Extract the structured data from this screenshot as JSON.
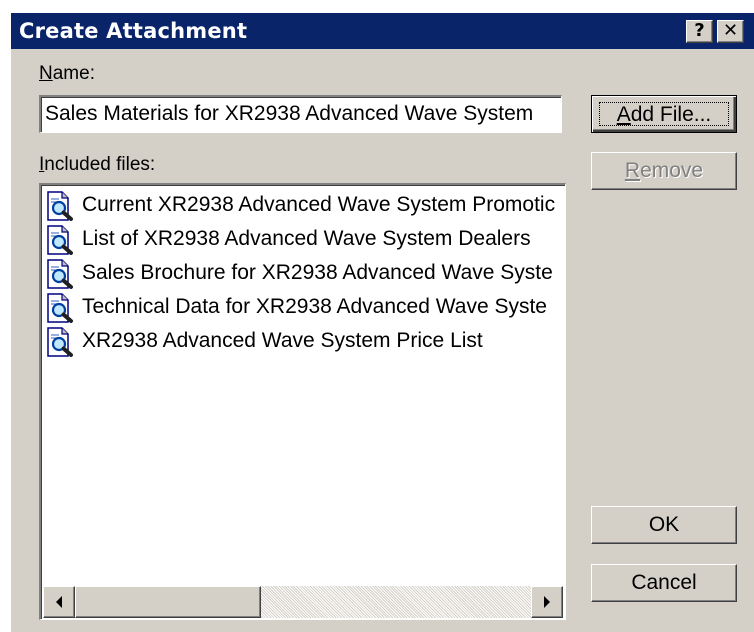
{
  "window": {
    "title": "Create Attachment",
    "help_label": "?",
    "close_label": "✕"
  },
  "name_field": {
    "label_mnemonic": "N",
    "label_rest": "ame:",
    "value": "Sales Materials for XR2938 Advanced Wave System"
  },
  "included_files": {
    "label_mnemonic": "I",
    "label_rest": "ncluded files:",
    "items": [
      {
        "label": "Current XR2938 Advanced Wave System Promotic",
        "icon": "document-magnifier-icon"
      },
      {
        "label": "List of XR2938 Advanced Wave System Dealers",
        "icon": "document-magnifier-icon"
      },
      {
        "label": "Sales Brochure for XR2938 Advanced Wave Syste",
        "icon": "document-magnifier-icon"
      },
      {
        "label": "Technical Data for XR2938 Advanced Wave Syste",
        "icon": "document-magnifier-icon"
      },
      {
        "label": "XR2938 Advanced Wave System Price List",
        "icon": "document-magnifier-icon"
      }
    ]
  },
  "buttons": {
    "add_file_mnemonic": "A",
    "add_file_rest": "dd File...",
    "remove_mnemonic": "R",
    "remove_rest": "emove",
    "ok": "OK",
    "cancel": "Cancel"
  },
  "colors": {
    "titlebar": "#0a246a",
    "face": "#d4d0c8"
  }
}
